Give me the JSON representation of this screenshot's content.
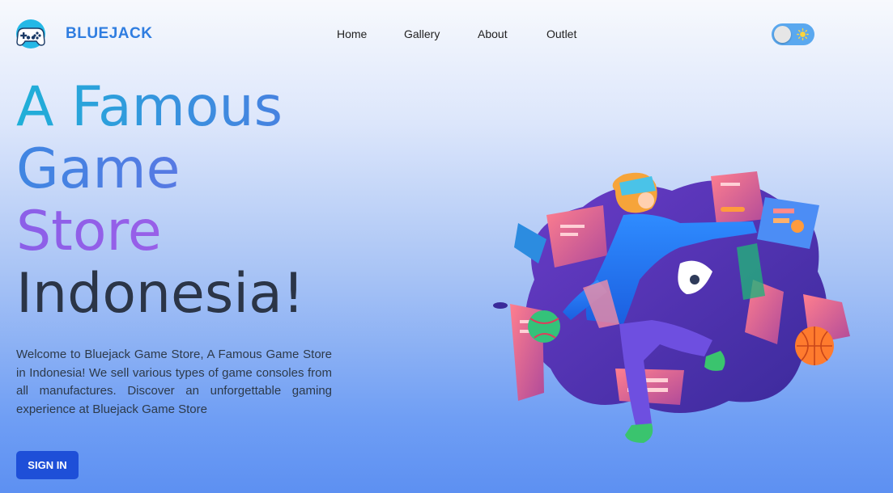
{
  "nav": {
    "brand": "BLUEJACK",
    "logo_icon": "gamepad-icon",
    "items": [
      {
        "label": "Home"
      },
      {
        "label": "Gallery"
      },
      {
        "label": "About"
      },
      {
        "label": "Outlet"
      }
    ],
    "theme_toggle": {
      "state": "light",
      "icon": "sun-icon"
    }
  },
  "hero": {
    "title_lines": [
      "A Famous",
      "Game",
      "Store",
      "Indonesia!"
    ],
    "description": "Welcome to Bluejack Game Store, A Famous Game Store in Indonesia! We sell various types of game consoles from all manufactures. Discover an unforgettable gaming experience at Bluejack Game Store",
    "cta_label": "SIGN IN",
    "illustration_icon": "shopping-gamer-illustration"
  },
  "colors": {
    "brand": "#2f7de0",
    "cta": "#1e4fd8",
    "toggle": "#5aa8ef",
    "text_dark": "#2b3547"
  }
}
